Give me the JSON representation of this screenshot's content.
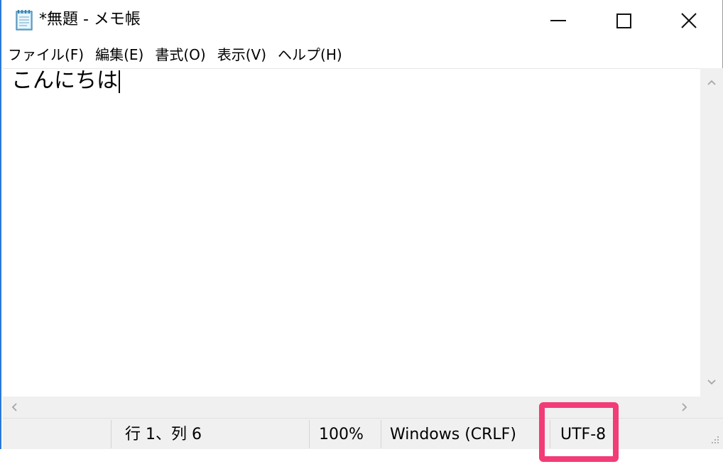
{
  "titlebar": {
    "title": "*無題 - メモ帳",
    "app_icon": "notepad-icon",
    "minimize_icon": "minimize-icon",
    "maximize_icon": "maximize-icon",
    "close_icon": "close-icon"
  },
  "menu": {
    "items": [
      {
        "label": "ファイル(F)"
      },
      {
        "label": "編集(E)"
      },
      {
        "label": "書式(O)"
      },
      {
        "label": "表示(V)"
      },
      {
        "label": "ヘルプ(H)"
      }
    ]
  },
  "editor": {
    "text": "こんにちは"
  },
  "statusbar": {
    "position": "行 1、列 6",
    "zoom": "100%",
    "line_ending": "Windows (CRLF)",
    "encoding": "UTF-8"
  },
  "colors": {
    "highlight": "#f23c77",
    "window_border": "#2b78d6",
    "chrome": "#f0f0f0"
  }
}
